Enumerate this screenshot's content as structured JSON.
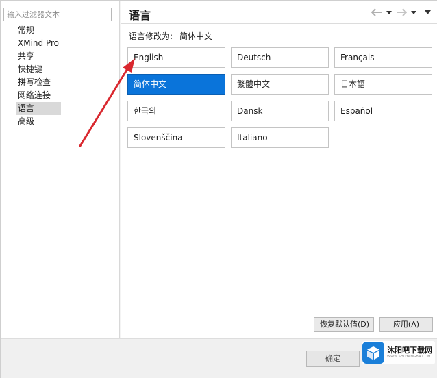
{
  "filter": {
    "placeholder": "输入过滤器文本"
  },
  "sidebar": {
    "items": [
      {
        "label": "常规"
      },
      {
        "label": "XMind Pro"
      },
      {
        "label": "共享"
      },
      {
        "label": "快捷键"
      },
      {
        "label": "拼写检查"
      },
      {
        "label": "网络连接"
      },
      {
        "label": "语言"
      },
      {
        "label": "高级"
      }
    ],
    "selected_index": 6
  },
  "header": {
    "title": "语言"
  },
  "status": {
    "label": "语言修改为:",
    "value": "简体中文"
  },
  "languages": [
    "English",
    "Deutsch",
    "Français",
    "简体中文",
    "繁體中文",
    "日本語",
    "한국의",
    "Dansk",
    "Español",
    "Slovenščina",
    "Italiano"
  ],
  "selected_language": "简体中文",
  "buttons": {
    "restore_defaults": "恢复默认值(D)",
    "apply": "应用(A)",
    "ok": "确定"
  },
  "watermark": {
    "title": "沐阳吧下载网",
    "subtitle": "WWW.SHUYANGBA.COM"
  },
  "colors": {
    "accent": "#0a74da",
    "annotation_arrow": "#d9282f"
  },
  "icons": {
    "back": "arrow-left-icon",
    "forward": "arrow-right-icon",
    "dropdown": "chevron-down-icon"
  }
}
